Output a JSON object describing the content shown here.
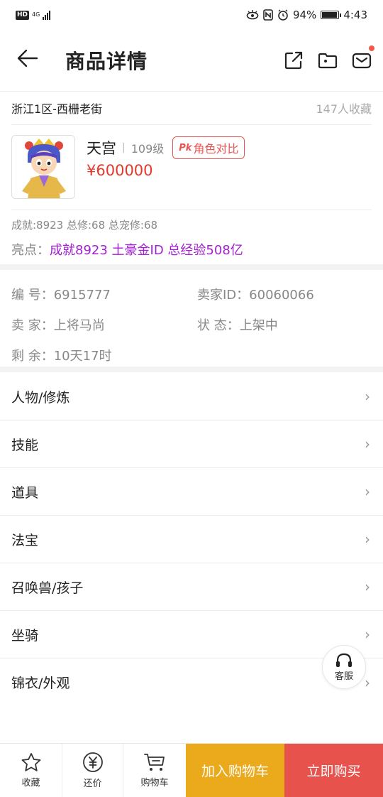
{
  "status_bar": {
    "hd": "HD",
    "network": "4G",
    "battery": "94%",
    "time": "4:43"
  },
  "header": {
    "title": "商品详情"
  },
  "server": {
    "name": "浙江1区-西栅老街",
    "favorites": "147人收藏"
  },
  "role": {
    "name": "天宫",
    "level": "109级",
    "pk_icon": "Pk",
    "compare_label": "角色对比",
    "price": "¥600000"
  },
  "stats": "成就:8923 总修:68 总宠修:68",
  "highlight": {
    "label": "亮点：",
    "value": "成就8923 土豪金ID 总经验508亿"
  },
  "info": {
    "number": "编  号：6915777",
    "seller_id": "卖家ID：60060066",
    "seller": "卖  家：上将马尚",
    "status": "状  态：上架中",
    "remaining": "剩  余：10天17时"
  },
  "menu": [
    {
      "label": "人物/修炼"
    },
    {
      "label": "技能"
    },
    {
      "label": "道具"
    },
    {
      "label": "法宝"
    },
    {
      "label": "召唤兽/孩子"
    },
    {
      "label": "坐骑"
    },
    {
      "label": "锦衣/外观"
    }
  ],
  "customer_service": "客服",
  "bottom": {
    "favorite": "收藏",
    "bargain": "还价",
    "cart": "购物车",
    "add_to_cart": "加入购物车",
    "buy_now": "立即购买"
  },
  "colors": {
    "price": "#e5382c",
    "highlight": "#a41fd1",
    "cart_button": "#eaaa1b",
    "buy_button": "#e8524c"
  }
}
